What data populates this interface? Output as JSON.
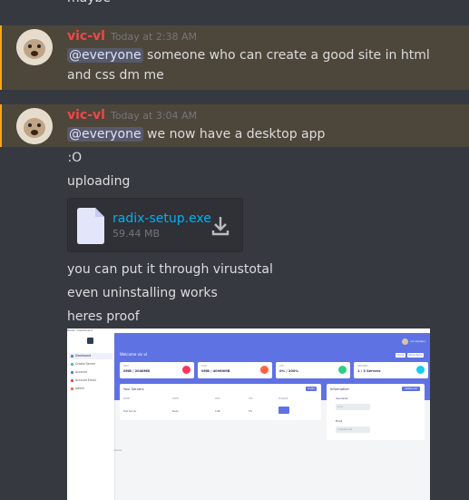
{
  "previous": {
    "cutoff_text": "maybe"
  },
  "messages": [
    {
      "username": "vic-vl",
      "timestamp": "Today at 2:38 AM",
      "mention": "@everyone",
      "text": " someone who can create a good site in html and css dm me"
    },
    {
      "username": "vic-vl",
      "timestamp": "Today at 3:04 AM",
      "mention": "@everyone",
      "text": " we now have a desktop app",
      "lines": [
        " :O",
        "uploading"
      ],
      "after_lines": [
        "you can put it through virustotal",
        "even uninstalling works",
        "heres proof"
      ],
      "attachment": {
        "name": "radix-setup.exe",
        "size": "59.44 MB",
        "icon": "file-icon",
        "action_icon": "download-icon"
      }
    }
  ],
  "colors": {
    "username": "#f04747",
    "mention_bg": "#faa61a",
    "link": "#00b0f4",
    "dashboard_accent": "#5f72e4"
  },
  "embed": {
    "window_title": "Radix - Dashboard",
    "sidebar": [
      "Dashboard",
      "Create Server",
      "Account",
      "Account Email",
      "Admin"
    ],
    "welcome": "Welcome vic-vl",
    "user": "vic-vl(user)",
    "buttons": [
      "Home",
      "Store Items"
    ],
    "stats": [
      {
        "label": "RAM",
        "value": "0MB / 2048MB",
        "color": "#f5365c"
      },
      {
        "label": "DISK",
        "value": "0MB / 40960MB",
        "color": "#fb6340"
      },
      {
        "label": "CPU",
        "value": "0% / 200%",
        "color": "#2dce89"
      },
      {
        "label": "SERVERS",
        "value": "1 / 3 Servers",
        "color": "#11cdef"
      }
    ],
    "servers_panel": {
      "title": "Your Servers",
      "button": "Create",
      "headers": [
        "NAME",
        "NODE",
        "RAM",
        "CPU",
        "MANAGE"
      ],
      "row": [
        "Test Server",
        "Node",
        "1GB",
        "5%"
      ]
    },
    "info_panel": {
      "title": "Information",
      "button": "Update Info",
      "fields": [
        {
          "label": "Username",
          "value": "vic-vl"
        },
        {
          "label": "Email",
          "value": "vic@radix.host"
        }
      ]
    },
    "stray": "Radix"
  }
}
